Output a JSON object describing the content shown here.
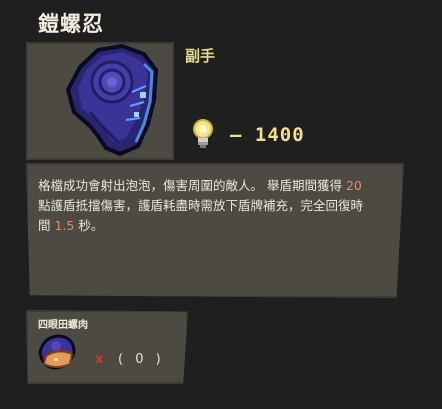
{
  "item": {
    "name": "鎧螺忍",
    "type": "副手",
    "price_prefix": "–",
    "price": "1400",
    "description": {
      "line1_pre": "格檔成功會射出泡泡，傷害周圍的敵人。 舉盾期間獲得 ",
      "shield_value": "20",
      "line2": "點護盾抵擋傷害，護盾耗盡時需放下盾牌補充，完全回復時",
      "line3_pre": "間 ",
      "time_value": "1.5",
      "line3_post": " 秒。"
    }
  },
  "material": {
    "name": "四眼田螺肉",
    "multiplier": "x",
    "count": "( 0 )"
  },
  "icons": {
    "item": "armored-snail-shield-icon",
    "currency": "lightbulb-icon",
    "material": "snail-meat-icon"
  },
  "colors": {
    "background": "#1f1f1f",
    "panel": "#4c4a43",
    "item_type": "#e6d98c",
    "price": "#f0e08a",
    "highlight_number": "#d9906a",
    "multiplier": "#c83a2a"
  }
}
